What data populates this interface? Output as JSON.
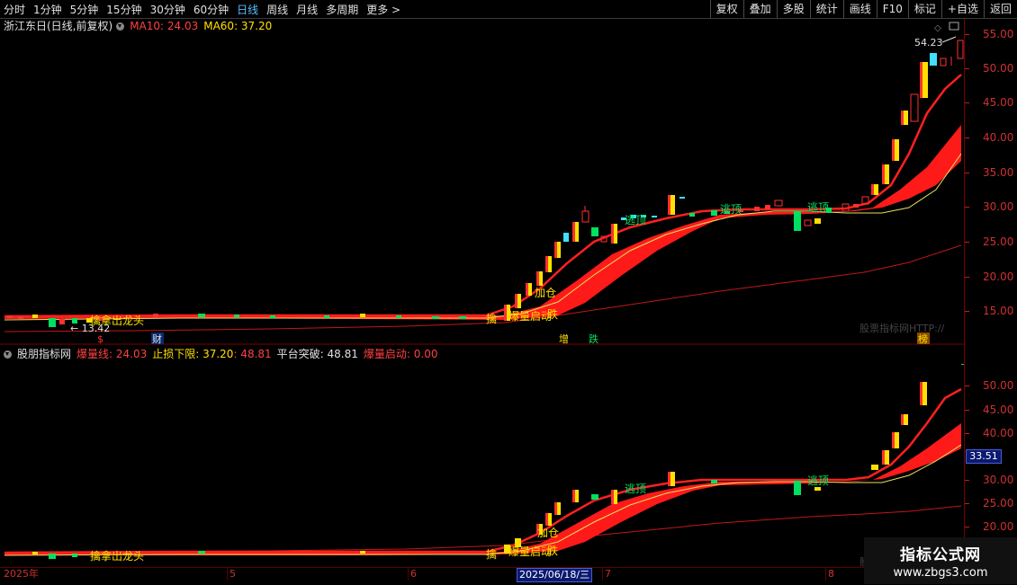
{
  "toolbar": {
    "periods": [
      "分时",
      "1分钟",
      "5分钟",
      "15分钟",
      "30分钟",
      "60分钟",
      "日线",
      "周线",
      "月线",
      "多周期",
      "更多 >"
    ],
    "active_period": "日线",
    "buttons": [
      "复权",
      "叠加",
      "多股",
      "统计",
      "画线",
      "F10",
      "标记",
      "+自选",
      "返回"
    ]
  },
  "main_panel": {
    "stock_title": "浙江东日(日线,前复权)",
    "ma10": "MA10: 24.03",
    "ma60": "MA60: 37.20",
    "y_labels": [
      "55.00",
      "50.00",
      "45.00",
      "40.00",
      "35.00",
      "30.00",
      "25.00",
      "20.00",
      "15.00"
    ],
    "high_label": "54.23",
    "low_label": "← 13.42",
    "signals": {
      "escape_top_1": "逃顶",
      "escape_top_2": "逃顶",
      "escape_top_3": "逃顶",
      "add_position": "加仓",
      "burst_start": "爆量启动",
      "catch_dragon": "擒拿出龙头",
      "catch": "擒",
      "chase": "跌"
    },
    "bottom_markers": [
      "$",
      "财",
      "增",
      "跌",
      "榜"
    ],
    "source_text": "股票指标网HTTP://"
  },
  "sub_panel": {
    "title": "股朋指标网",
    "burst_line": "爆量线: 24.03",
    "stop_loss": "止损下限: 37.20",
    "stop_loss_2": ": 48.81",
    "platform_break": "平台突破: 48.81",
    "burst_start": "爆量启动: 0.00",
    "y_labels": [
      "50.00",
      "45.00",
      "40.00",
      "35.00",
      "30.00",
      "25.00",
      "20.00"
    ],
    "current_price": "33.51",
    "signals": {
      "escape_top_1": "逃顶",
      "escape_top_2": "逃顶",
      "add_position": "加仓",
      "burst_start": "爆量启动",
      "catch_dragon": "擒拿出龙头",
      "catch": "擒",
      "chase": "跌"
    },
    "source_text": "股票"
  },
  "date_axis": {
    "year_label": "2025年",
    "months": [
      "5",
      "6",
      "7",
      "8"
    ],
    "selected_date": "2025/06/18/三"
  },
  "watermark": {
    "title": "指标公式网",
    "url": "www.zbgs3.com"
  },
  "colors": {
    "up": "#ff3030",
    "down": "#00e060",
    "cyan": "#40e0ff",
    "yellow": "#ffe000",
    "ma_red": "#ff2020",
    "band": "#ff1a1a",
    "thin_yellow": "#e8e060"
  }
}
